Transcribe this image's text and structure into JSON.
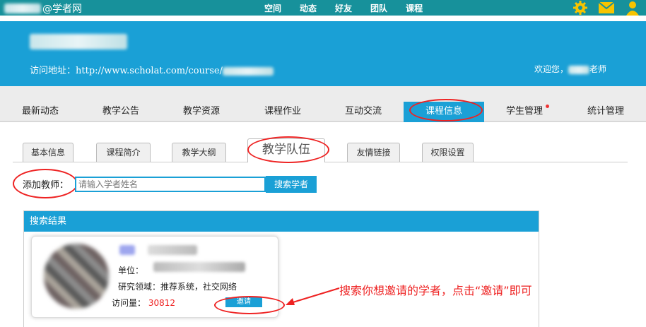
{
  "topbar": {
    "site_name": "@学者网",
    "nav": [
      "空间",
      "动态",
      "好友",
      "团队",
      "课程"
    ],
    "icons": [
      "gear-icon",
      "mail-icon",
      "user-icon"
    ]
  },
  "banner": {
    "url_label": "访问地址：",
    "url_value": "http://www.scholat.com/course/",
    "welcome_prefix": "欢迎您，",
    "welcome_suffix": "老师"
  },
  "main_nav": {
    "items": [
      "最新动态",
      "教学公告",
      "教学资源",
      "课程作业",
      "互动交流",
      "课程信息",
      "学生管理",
      "统计管理"
    ],
    "active": "课程信息"
  },
  "sub_tabs": {
    "items": [
      "基本信息",
      "课程简介",
      "教学大纲",
      "教学队伍",
      "友情链接",
      "权限设置"
    ],
    "active": "教学队伍"
  },
  "add_teacher": {
    "label": "添加教师：",
    "placeholder": "请输入学者姓名",
    "button": "搜索学者"
  },
  "results": {
    "title": "搜索结果",
    "card": {
      "unit_label": "单位：",
      "research_label": "研究领域：",
      "research_value": "推荐系统，社交网络",
      "visits_label": "访问量：",
      "visits_value": "30812",
      "invite_button": "邀请"
    }
  },
  "annotation": {
    "text": "搜索你想邀请的学者，点击“邀请”即可"
  },
  "colors": {
    "topbar": "#17919b",
    "accent": "#1aa0d6",
    "highlight": "#e22222"
  }
}
